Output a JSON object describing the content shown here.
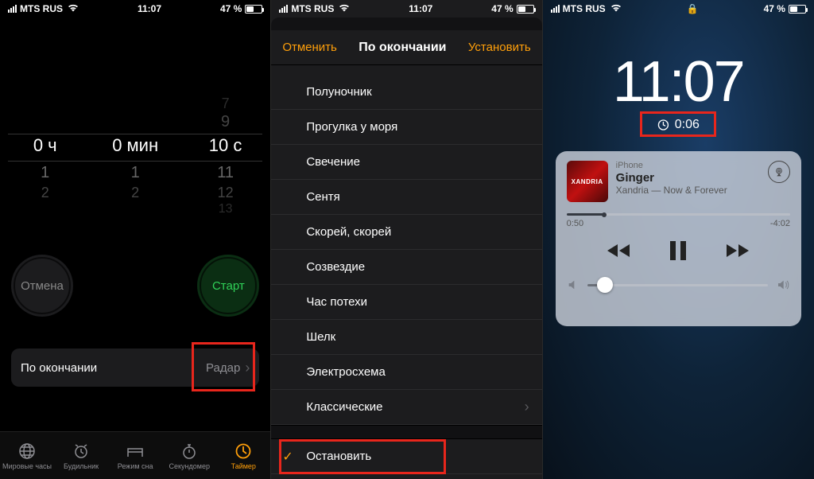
{
  "status": {
    "carrier": "MTS RUS",
    "time": "11:07",
    "battery_pct": "47 %"
  },
  "p1": {
    "picker": {
      "hours": {
        "t1": "",
        "t2": "",
        "sel": "0 ч",
        "b1": "1",
        "b2": "2",
        "b3": ""
      },
      "minutes": {
        "t1": "",
        "t2": "",
        "sel": "0 мин",
        "b1": "1",
        "b2": "2",
        "b3": ""
      },
      "seconds": {
        "t1": "7",
        "t2": "9",
        "sel": "10 с",
        "b1": "11",
        "b2": "12",
        "b3": "13"
      }
    },
    "cancel": "Отмена",
    "start": "Старт",
    "when_label": "По окончании",
    "when_value": "Радар",
    "tabs": {
      "world": "Мировые часы",
      "alarm": "Будильник",
      "sleep": "Режим сна",
      "stopw": "Секундомер",
      "timer": "Таймер"
    }
  },
  "p2": {
    "cancel": "Отменить",
    "title": "По окончании",
    "set": "Установить",
    "items": [
      "Полуночник",
      "Прогулка у моря",
      "Свечение",
      "Сентя",
      "Скорей, скорей",
      "Созвездие",
      "Час потехи",
      "Шелк",
      "Электросхема"
    ],
    "classic": "Классические",
    "stop": "Остановить"
  },
  "p3": {
    "bigtime": "11:07",
    "timer_left": "0:06",
    "media": {
      "source": "iPhone",
      "title": "Ginger",
      "subtitle": "Xandria — Now & Forever",
      "art_text": "XANDRIA",
      "elapsed": "0:50",
      "remaining": "-4:02"
    }
  }
}
